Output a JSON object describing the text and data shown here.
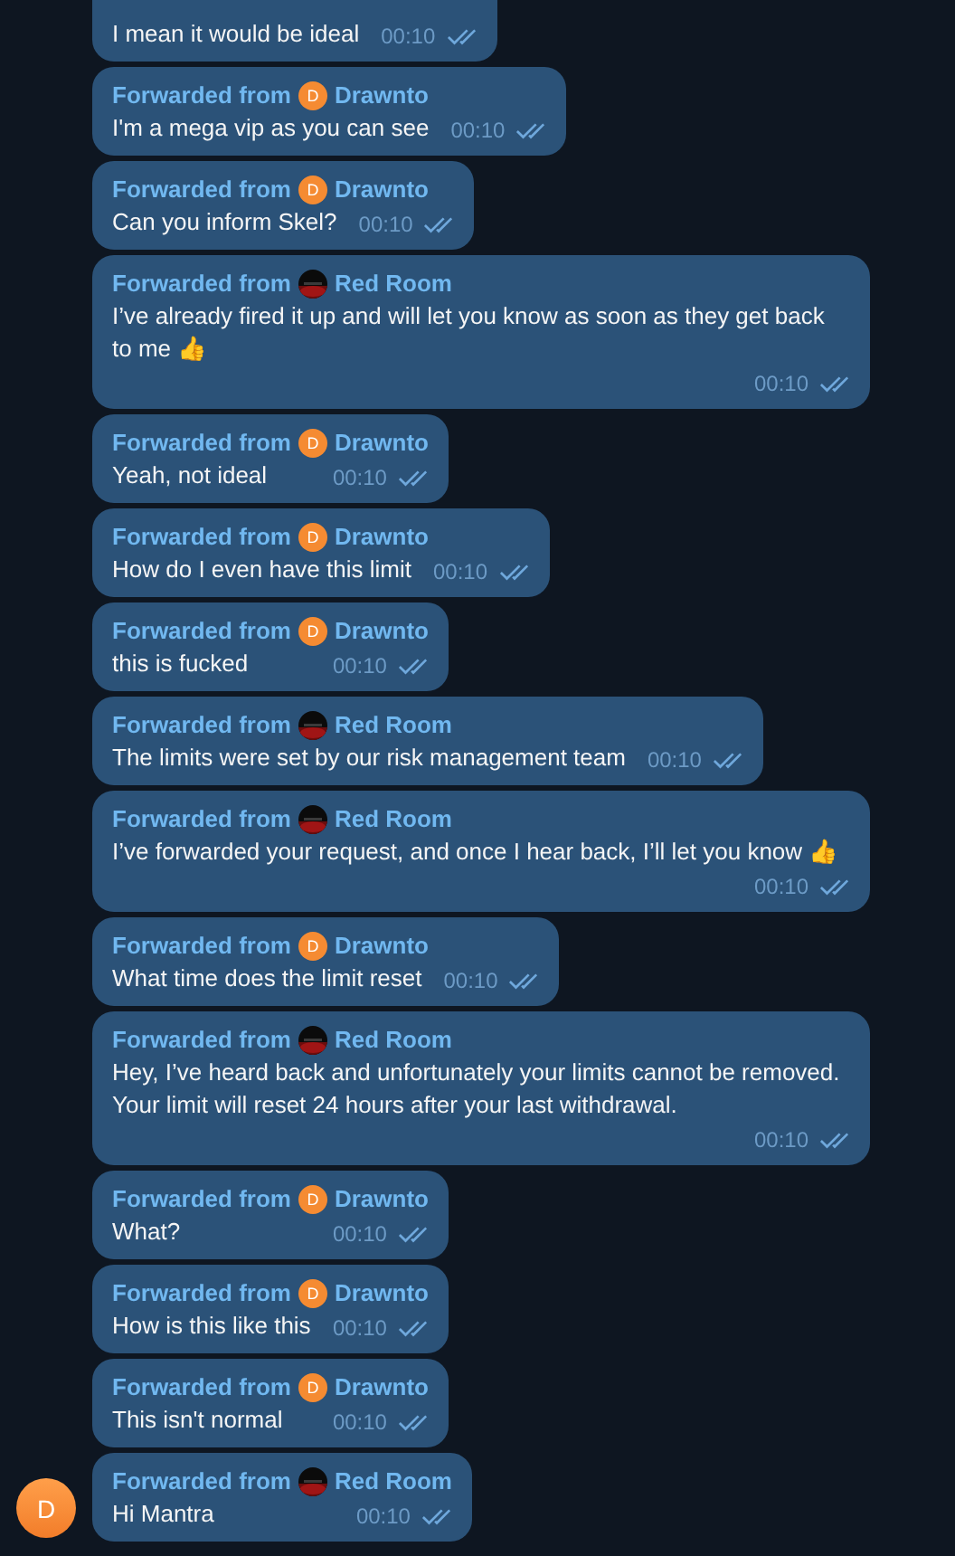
{
  "messages": [
    {
      "text": "I mean it would be ideal",
      "time": "00:10",
      "read": true
    },
    {
      "forward_label": "Forwarded from",
      "source": "Drawnto",
      "source_avatar": {
        "kind": "letter",
        "letter": "D"
      },
      "text": "I'm a mega vip as you can see",
      "time": "00:10",
      "read": true
    },
    {
      "forward_label": "Forwarded from",
      "source": "Drawnto",
      "source_avatar": {
        "kind": "letter",
        "letter": "D"
      },
      "text": "Can you inform Skel?",
      "time": "00:10",
      "read": true
    },
    {
      "forward_label": "Forwarded from",
      "source": "Red Room",
      "text": "I’ve already fired it up and will let you know as soon as they get back to me 👍",
      "time": "00:10",
      "read": true
    },
    {
      "forward_label": "Forwarded from",
      "source": "Drawnto",
      "source_avatar": {
        "kind": "letter",
        "letter": "D"
      },
      "text": "Yeah, not ideal",
      "time": "00:10",
      "read": true
    },
    {
      "forward_label": "Forwarded from",
      "source": "Drawnto",
      "source_avatar": {
        "kind": "letter",
        "letter": "D"
      },
      "text": "How do I even have this limit",
      "time": "00:10",
      "read": true
    },
    {
      "forward_label": "Forwarded from",
      "source": "Drawnto",
      "source_avatar": {
        "kind": "letter",
        "letter": "D"
      },
      "text": "this is fucked",
      "time": "00:10",
      "read": true
    },
    {
      "forward_label": "Forwarded from",
      "source": "Red Room",
      "text": "The limits were set by our risk management team",
      "time": "00:10",
      "read": true
    },
    {
      "forward_label": "Forwarded from",
      "source": "Red Room",
      "text": "I’ve forwarded your request, and once I hear back, I’ll let you know 👍",
      "time": "00:10",
      "read": true
    },
    {
      "forward_label": "Forwarded from",
      "source": "Drawnto",
      "source_avatar": {
        "kind": "letter",
        "letter": "D"
      },
      "text": "What time does the limit reset",
      "time": "00:10",
      "read": true
    },
    {
      "forward_label": "Forwarded from",
      "source": "Red Room",
      "text": "Hey, I’ve heard back and unfortunately your limits cannot be removed. Your limit will reset 24 hours after your last withdrawal.",
      "time": "00:10",
      "read": true
    },
    {
      "forward_label": "Forwarded from",
      "source": "Drawnto",
      "source_avatar": {
        "kind": "letter",
        "letter": "D"
      },
      "text": "What?",
      "time": "00:10",
      "read": true
    },
    {
      "forward_label": "Forwarded from",
      "source": "Drawnto",
      "source_avatar": {
        "kind": "letter",
        "letter": "D"
      },
      "text": "How is this like this",
      "time": "00:10",
      "read": true
    },
    {
      "forward_label": "Forwarded from",
      "source": "Drawnto",
      "source_avatar": {
        "kind": "letter",
        "letter": "D"
      },
      "text": "This isn't normal",
      "time": "00:10",
      "read": true
    },
    {
      "forward_label": "Forwarded from",
      "source": "Red Room",
      "text": "Hi Mantra",
      "time": "00:10",
      "read": true,
      "avatar_letter": "D"
    }
  ]
}
